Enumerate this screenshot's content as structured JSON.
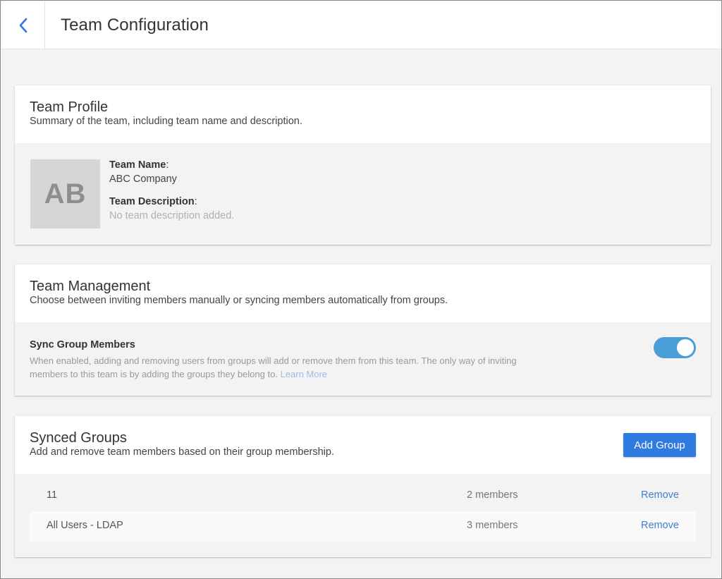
{
  "header": {
    "back_icon": "chevron-left-icon",
    "title": "Team Configuration"
  },
  "team_profile": {
    "title": "Team Profile",
    "subtitle": "Summary of the team, including team name and description.",
    "avatar_initials": "AB",
    "name_label": "Team Name",
    "name_value": "ABC Company",
    "description_label": "Team Description",
    "description_value": "No team description added."
  },
  "team_management": {
    "title": "Team Management",
    "subtitle": "Choose between inviting members manually or syncing members automatically from groups.",
    "sync_title": "Sync Group Members",
    "sync_description": "When enabled, adding and removing users from groups will add or remove them from this team. The only way of inviting members to this team is by adding the groups they belong to.",
    "learn_more": "Learn More",
    "sync_enabled": true
  },
  "synced_groups": {
    "title": "Synced Groups",
    "subtitle": "Add and remove team members based on their group membership.",
    "add_button": "Add Group",
    "rows": [
      {
        "name": "11",
        "members": "2 members",
        "action": "Remove"
      },
      {
        "name": "All Users - LDAP",
        "members": "3 members",
        "action": "Remove"
      }
    ]
  },
  "colors": {
    "accent": "#2f7be0",
    "toggle_on": "#4a9ed8",
    "link": "#3f7fcf",
    "background": "#f3f3f3"
  }
}
